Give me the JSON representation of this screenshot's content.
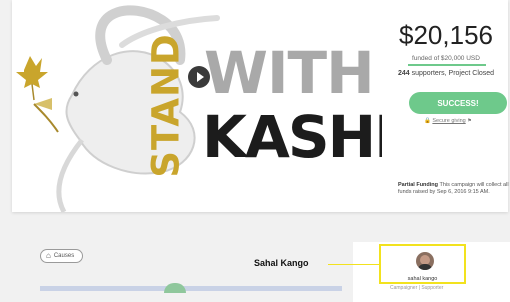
{
  "campaign": {
    "image_words": {
      "stand": "STAND",
      "with": "WITH",
      "kashm": "KASHM"
    },
    "amount": "$20,156",
    "funded_text": "funded of $20,000 USD",
    "supporters_count": "244",
    "supporters_text": "supporters, Project Closed",
    "cta_label": "SUCCESS!",
    "secure_label": "Secure giving",
    "partial_title": "Partial Funding",
    "partial_text": "This campaign will collect all funds raised by Sep 6, 2016 9:15 AM."
  },
  "tags": [
    {
      "label": "Causes"
    }
  ],
  "creator": {
    "name": "sahal kango",
    "meta": "Campaigner | Supporter"
  },
  "annotation": {
    "label": "Sahal Kango"
  },
  "colors": {
    "gold": "#c9a52c",
    "green": "#6ec98b",
    "highlight": "#f2e21e"
  },
  "icons": {
    "play": "play-icon",
    "tag": "tag-icon",
    "lock": "lock-icon",
    "flag": "flag-icon",
    "leaf": "maple-leaf-icon"
  }
}
